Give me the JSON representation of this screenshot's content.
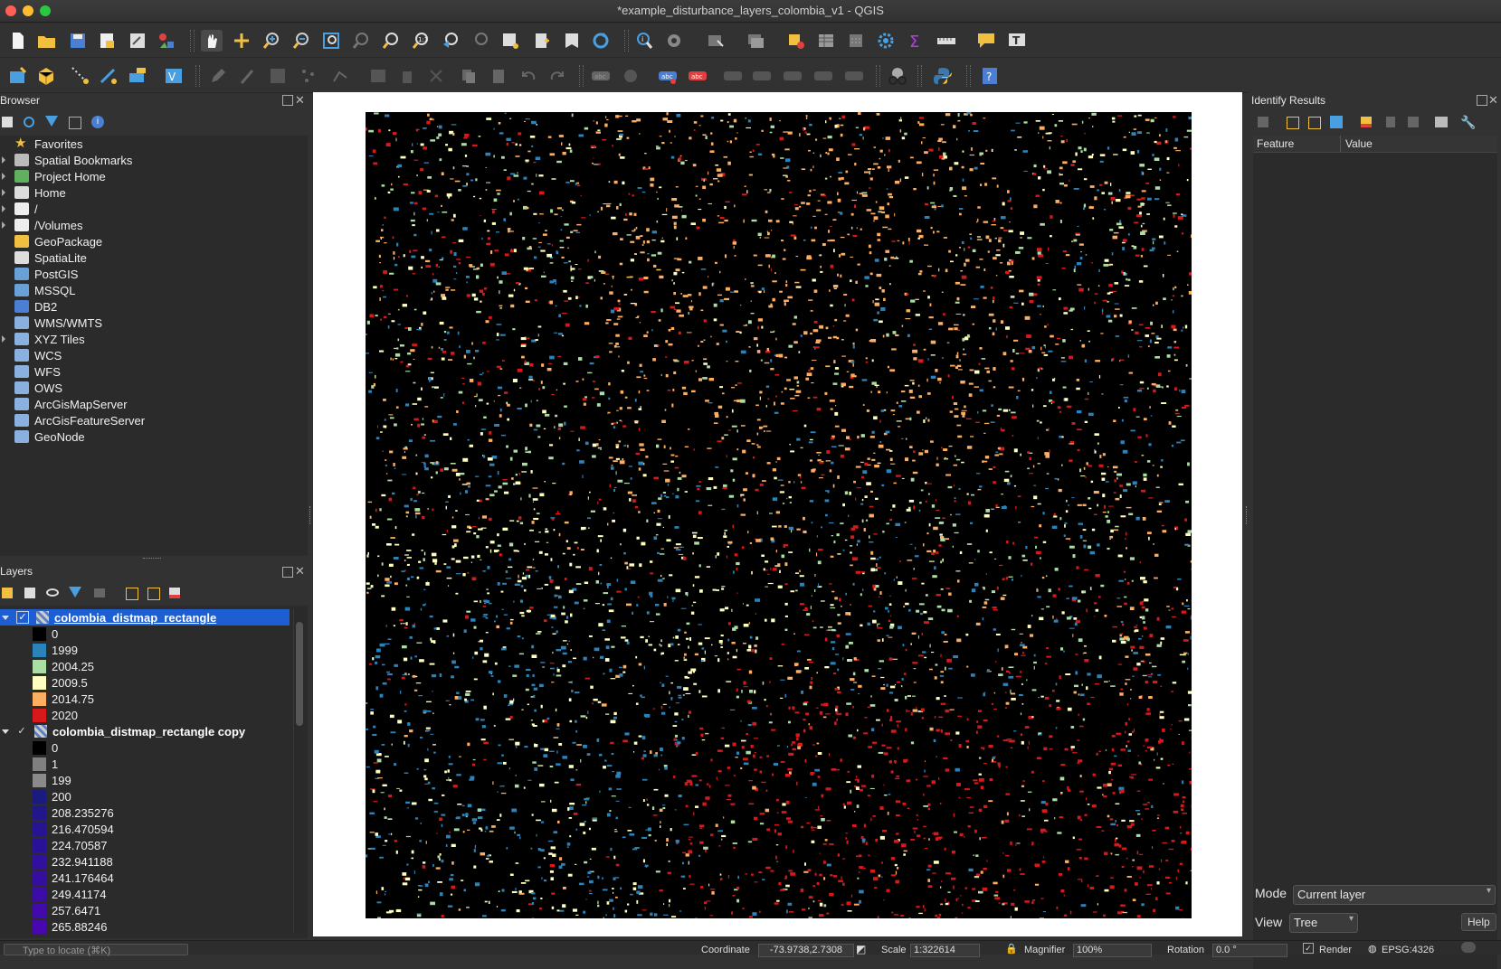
{
  "window": {
    "title": "*example_disturbance_layers_colombia_v1 - QGIS"
  },
  "browser": {
    "title": "Browser",
    "items": [
      {
        "label": "Favorites",
        "icon": "star-icon",
        "arrow": false
      },
      {
        "label": "Spatial Bookmarks",
        "icon": "bookmarks-icon",
        "arrow": true
      },
      {
        "label": "Project Home",
        "icon": "project-home-icon",
        "arrow": true
      },
      {
        "label": "Home",
        "icon": "home-folder-icon",
        "arrow": true
      },
      {
        "label": "/",
        "icon": "folder-icon",
        "arrow": true
      },
      {
        "label": "/Volumes",
        "icon": "folder-icon",
        "arrow": true
      },
      {
        "label": "GeoPackage",
        "icon": "geopackage-icon",
        "arrow": false
      },
      {
        "label": "SpatiaLite",
        "icon": "spatialite-icon",
        "arrow": false
      },
      {
        "label": "PostGIS",
        "icon": "postgis-icon",
        "arrow": false
      },
      {
        "label": "MSSQL",
        "icon": "mssql-icon",
        "arrow": false
      },
      {
        "label": "DB2",
        "icon": "db2-icon",
        "arrow": false
      },
      {
        "label": "WMS/WMTS",
        "icon": "wms-icon",
        "arrow": false
      },
      {
        "label": "XYZ Tiles",
        "icon": "xyz-icon",
        "arrow": true
      },
      {
        "label": "WCS",
        "icon": "wcs-icon",
        "arrow": false
      },
      {
        "label": "WFS",
        "icon": "wfs-icon",
        "arrow": false
      },
      {
        "label": "OWS",
        "icon": "ows-icon",
        "arrow": false
      },
      {
        "label": "ArcGisMapServer",
        "icon": "arcgis-map-icon",
        "arrow": false
      },
      {
        "label": "ArcGisFeatureServer",
        "icon": "arcgis-feature-icon",
        "arrow": false
      },
      {
        "label": "GeoNode",
        "icon": "geonode-icon",
        "arrow": false
      }
    ]
  },
  "layers": {
    "title": "Layers",
    "layer1": {
      "name": "colombia_distmap_rectangle",
      "legend": [
        {
          "label": "0",
          "color": "#000000"
        },
        {
          "label": "1999",
          "color": "#2b83ba"
        },
        {
          "label": "2004.25",
          "color": "#abdda4"
        },
        {
          "label": "2009.5",
          "color": "#ffffbf"
        },
        {
          "label": "2014.75",
          "color": "#fdae61"
        },
        {
          "label": "2020",
          "color": "#d7191c"
        }
      ]
    },
    "layer2": {
      "name": "colombia_distmap_rectangle copy",
      "legend": [
        {
          "label": "0",
          "color": "#000000"
        },
        {
          "label": "1",
          "color": "#808080"
        },
        {
          "label": "199",
          "color": "#8a8a8a"
        },
        {
          "label": "200",
          "color": "#1a1a80"
        },
        {
          "label": "208.235276",
          "color": "#22178a"
        },
        {
          "label": "216.470594",
          "color": "#261490"
        },
        {
          "label": "224.70587",
          "color": "#2a1296"
        },
        {
          "label": "232.941188",
          "color": "#30109c"
        },
        {
          "label": "241.176464",
          "color": "#350ea0"
        },
        {
          "label": "249.41174",
          "color": "#3b0ca6"
        },
        {
          "label": "257.6471",
          "color": "#420aaa"
        },
        {
          "label": "265.88246",
          "color": "#4808ae"
        }
      ]
    }
  },
  "identify": {
    "title": "Identify Results",
    "col_feature": "Feature",
    "col_value": "Value",
    "mode_label": "Mode",
    "mode_value": "Current layer",
    "view_label": "View",
    "view_value": "Tree",
    "help": "Help"
  },
  "status": {
    "locator_placeholder": "Type to locate (⌘K)",
    "coordinate_label": "Coordinate",
    "coordinate_value": "-73.9738,2.7308",
    "scale_label": "Scale",
    "scale_value": "1:322614",
    "magnifier_label": "Magnifier",
    "magnifier_value": "100%",
    "rotation_label": "Rotation",
    "rotation_value": "0.0 °",
    "render_label": "Render",
    "crs": "EPSG:4326"
  },
  "colors": {
    "selected_row": "#1d5fd3",
    "panel_bg": "#2b2b2b"
  }
}
